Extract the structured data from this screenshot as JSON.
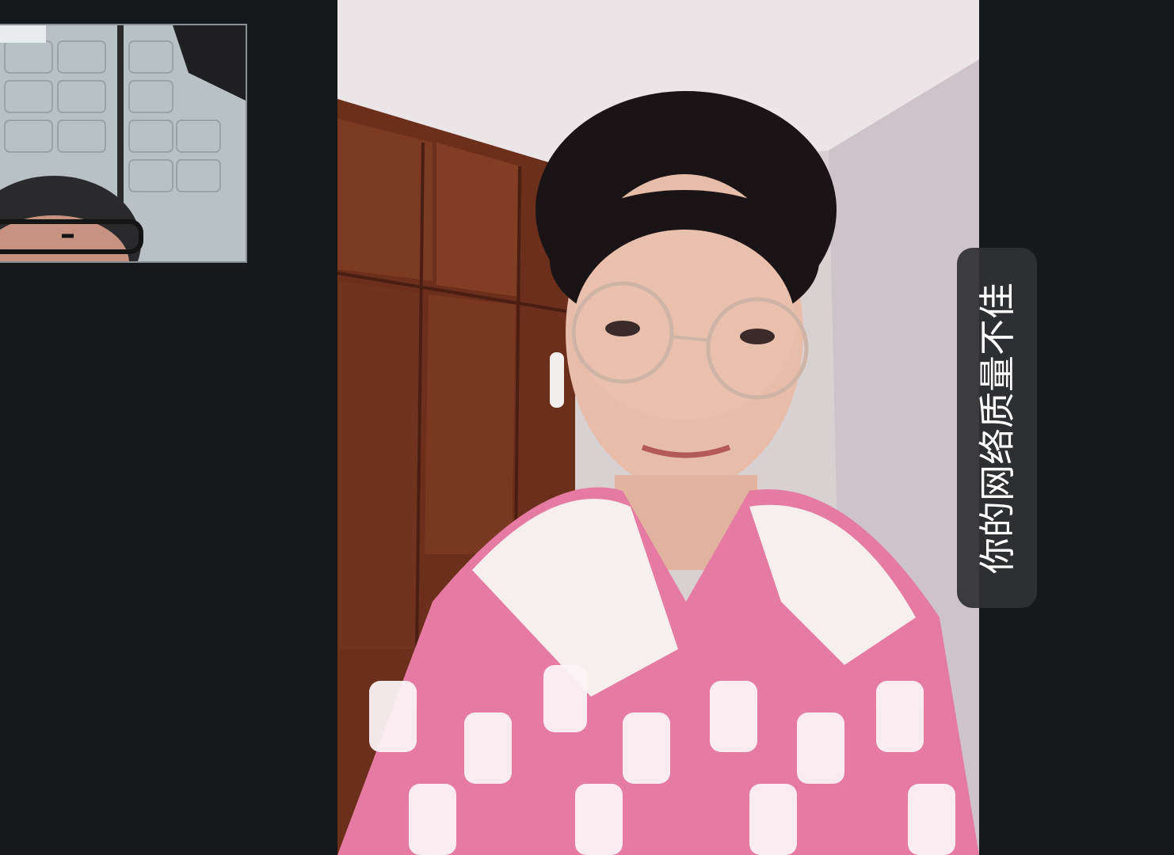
{
  "call": {
    "network_notice": "你的网络质量不佳"
  },
  "colors": {
    "background": "#15191c",
    "toast_background": "#303234",
    "toast_text": "#ffffff",
    "pip_border": "#8a8f93"
  }
}
